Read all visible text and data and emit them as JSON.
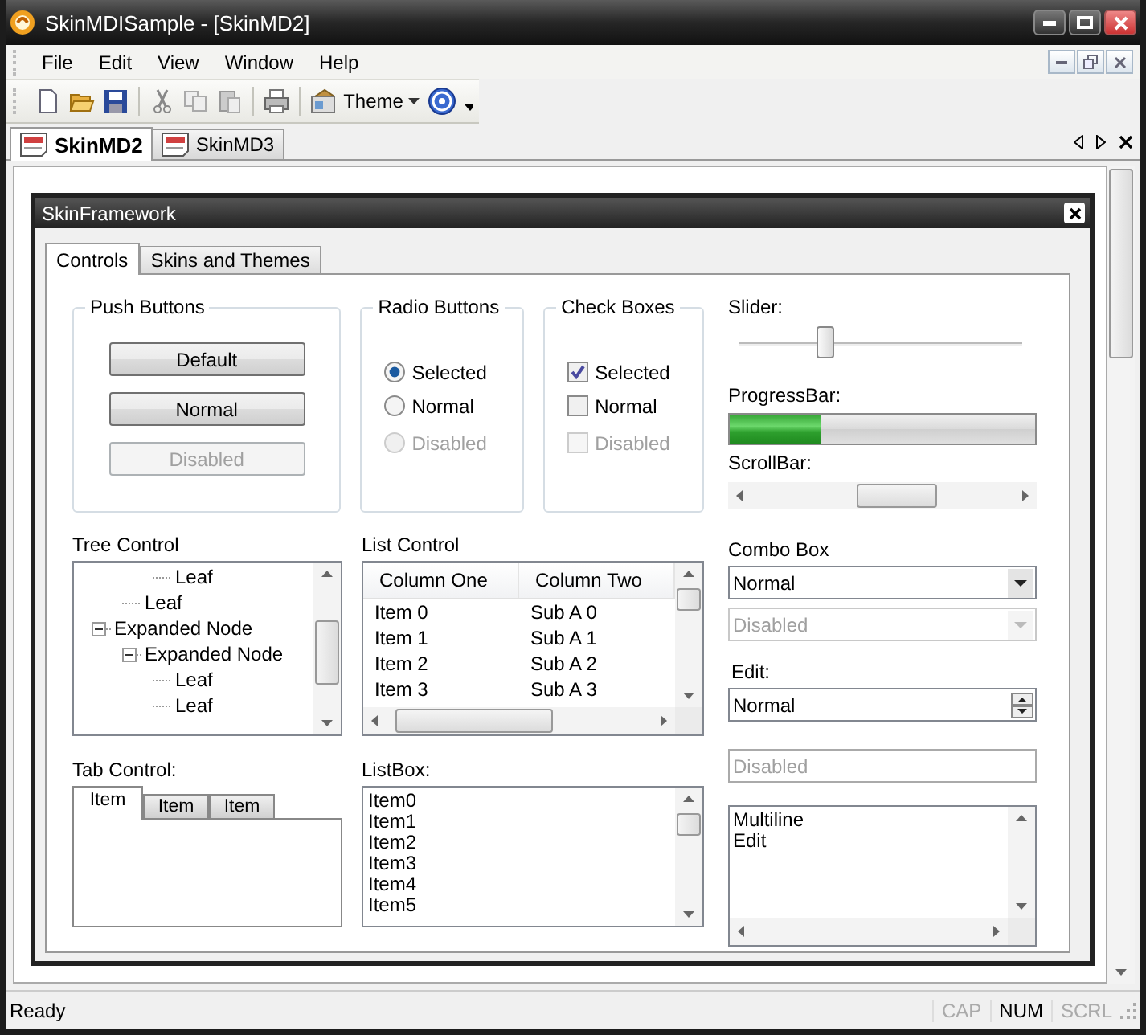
{
  "window": {
    "title": "SkinMDISample - [SkinMD2]"
  },
  "menu": [
    "File",
    "Edit",
    "View",
    "Window",
    "Help"
  ],
  "toolbar": {
    "theme_label": "Theme"
  },
  "document_tabs": [
    {
      "label": "SkinMD2",
      "selected": true
    },
    {
      "label": "SkinMD3",
      "selected": false
    }
  ],
  "dialog": {
    "title": "SkinFramework",
    "tabs": [
      {
        "label": "Controls",
        "selected": true
      },
      {
        "label": "Skins and Themes",
        "selected": false
      }
    ],
    "push_buttons": {
      "title": "Push Buttons",
      "buttons": [
        {
          "label": "Default",
          "disabled": false
        },
        {
          "label": "Normal",
          "disabled": false
        },
        {
          "label": "Disabled",
          "disabled": true
        }
      ]
    },
    "radio_buttons": {
      "title": "Radio Buttons",
      "items": [
        {
          "label": "Selected",
          "selected": true,
          "disabled": false
        },
        {
          "label": "Normal",
          "selected": false,
          "disabled": false
        },
        {
          "label": "Disabled",
          "selected": false,
          "disabled": true
        }
      ]
    },
    "check_boxes": {
      "title": "Check Boxes",
      "items": [
        {
          "label": "Selected",
          "checked": true,
          "disabled": false
        },
        {
          "label": "Normal",
          "checked": false,
          "disabled": false
        },
        {
          "label": "Disabled",
          "checked": false,
          "disabled": true
        }
      ]
    },
    "slider": {
      "label": "Slider:",
      "level": 0.3
    },
    "progress_bar": {
      "label": "ProgressBar:",
      "level": 0.3
    },
    "scroll_bar": {
      "label": "ScrollBar:"
    },
    "tree": {
      "label": "Tree Control",
      "items": [
        {
          "children": [
            {
              "children": [
                {
                  "label": "Leaf"
                }
              ]
            },
            {
              "label": "Leaf"
            }
          ]
        },
        {
          "label": "Expanded Node",
          "expanded": true,
          "children": [
            {
              "label": "Expanded Node",
              "expanded": true,
              "children": [
                {
                  "label": "Leaf"
                },
                {
                  "label": "Leaf"
                }
              ]
            }
          ]
        }
      ]
    },
    "list_control": {
      "label": "List Control",
      "columns": [
        "Column One",
        "Column Two"
      ],
      "rows": [
        [
          "Item 0",
          "Sub A 0"
        ],
        [
          "Item 1",
          "Sub A 1"
        ],
        [
          "Item 2",
          "Sub A 2"
        ],
        [
          "Item 3",
          "Sub A 3"
        ]
      ]
    },
    "tab_control": {
      "label": "Tab Control:",
      "tabs": [
        {
          "label": "Item",
          "selected": true
        },
        {
          "label": "Item",
          "selected": false
        },
        {
          "label": "Item",
          "selected": false
        }
      ]
    },
    "list_box": {
      "label": "ListBox:",
      "items": [
        "Item0",
        "Item1",
        "Item2",
        "Item3",
        "Item4",
        "Item5"
      ]
    },
    "combo_box": {
      "label": "Combo Box",
      "combos": [
        {
          "value": "Normal",
          "disabled": false
        },
        {
          "value": "Disabled",
          "disabled": true
        }
      ]
    },
    "edit": {
      "label": "Edit:",
      "spin_value": "Normal",
      "disabled_value": "Disabled",
      "multiline": [
        "Multiline",
        "Edit"
      ]
    }
  },
  "status_bar": {
    "text": "Ready",
    "indicators": [
      {
        "label": "CAP",
        "on": false
      },
      {
        "label": "NUM",
        "on": true
      },
      {
        "label": "SCRL",
        "on": false
      }
    ]
  }
}
